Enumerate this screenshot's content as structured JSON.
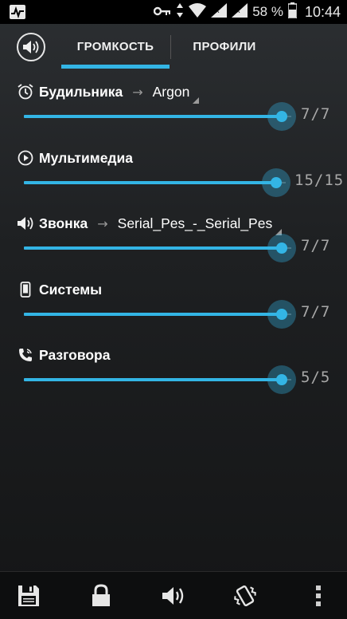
{
  "statusbar": {
    "battery_percent": "58 %",
    "time": "10:44",
    "icons": [
      "pulse-icon",
      "key-icon",
      "data-arrows-icon",
      "wifi-icon",
      "signal-icon",
      "signal-2-icon",
      "battery-icon"
    ]
  },
  "tabs": {
    "volume": "ГРОМКОСТЬ",
    "profiles": "ПРОФИЛИ",
    "active": "volume"
  },
  "colors": {
    "accent": "#33b5e5",
    "background": "#1e2022"
  },
  "streams": [
    {
      "key": "alarm",
      "icon": "alarm-clock-icon",
      "title": "Будильника",
      "ringtone": "Argon",
      "level": "7/7",
      "fraction": 1.0
    },
    {
      "key": "media",
      "icon": "play-icon",
      "title": "Мультимедиа",
      "ringtone": null,
      "level": "15/15",
      "fraction": 1.0
    },
    {
      "key": "ringer",
      "icon": "speaker-icon",
      "title": "Звонка",
      "ringtone": "Serial_Pes_-_Serial_Pes",
      "level": "7/7",
      "fraction": 1.0
    },
    {
      "key": "system",
      "icon": "phone-icon",
      "title": "Системы",
      "ringtone": null,
      "level": "7/7",
      "fraction": 1.0
    },
    {
      "key": "voice",
      "icon": "phone-call-icon",
      "title": "Разговора",
      "ringtone": null,
      "level": "5/5",
      "fraction": 1.0
    }
  ],
  "bottombar": [
    "save-icon",
    "lock-icon",
    "speaker-icon",
    "vibrate-icon",
    "overflow-menu-icon"
  ]
}
